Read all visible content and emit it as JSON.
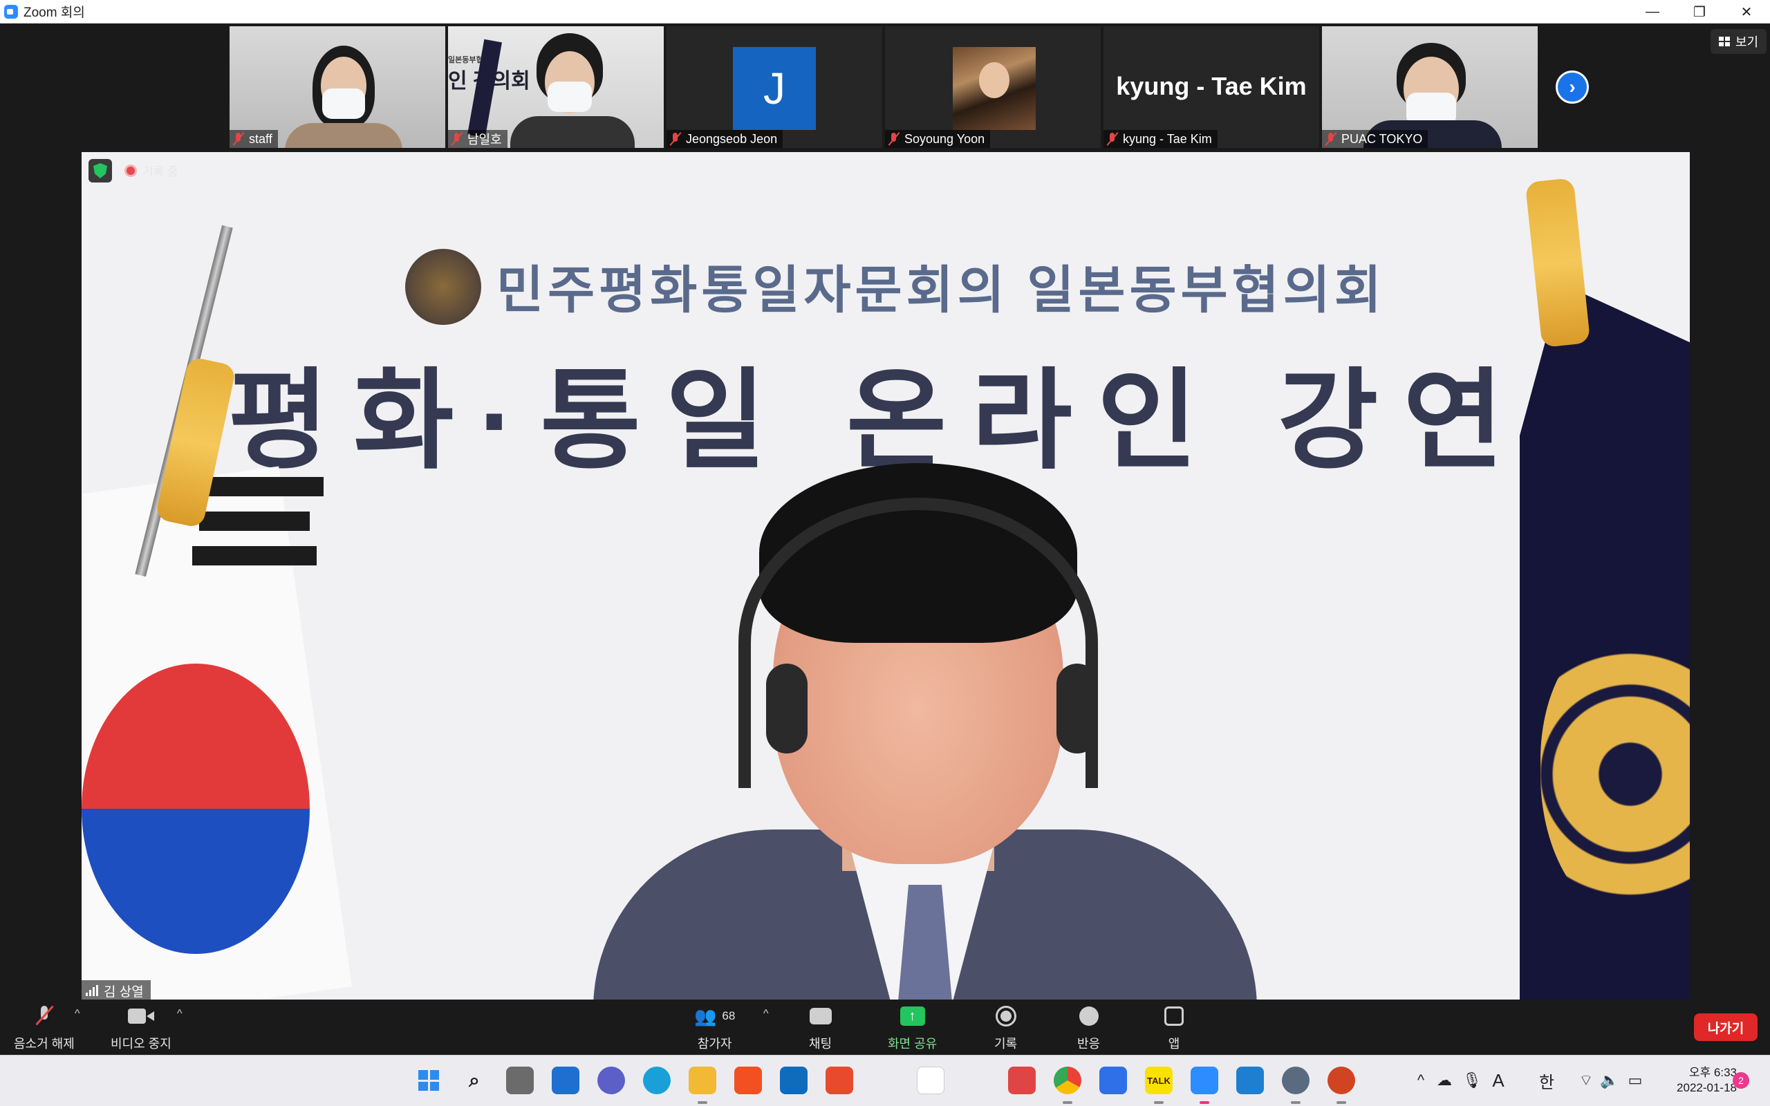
{
  "window": {
    "title": "Zoom 회의",
    "minimize": "—",
    "restore": "❐",
    "close": "✕"
  },
  "view_button": {
    "label": "보기"
  },
  "participants": [
    {
      "name": "staff",
      "type": "video"
    },
    {
      "name": "남일호",
      "type": "video"
    },
    {
      "name": "Jeongseob Jeon",
      "type": "avatar",
      "initial": "J"
    },
    {
      "name": "Soyoung Yoon",
      "type": "photo"
    },
    {
      "name": "kyung - Tae Kim",
      "type": "name-only",
      "display_name": "kyung - Tae Kim"
    },
    {
      "name": "PUAC TOKYO",
      "type": "video"
    }
  ],
  "thumbnail_banner_text": {
    "small": "일본동부협의",
    "large": "인 강의회"
  },
  "main_video": {
    "speaker": "김 상열",
    "recording_label": "기록 중",
    "banner_line1": "민주평화통일자문회의 일본동부협의회",
    "banner_line2": "평화·통일 온라인 강연"
  },
  "controls": {
    "unmute": "음소거 해제",
    "stop_video": "비디오 중지",
    "participants_label": "참가자",
    "participants_count": "68",
    "chat": "채팅",
    "share_screen": "화면 공유",
    "record": "기록",
    "reactions": "반응",
    "apps": "앱",
    "leave": "나가기"
  },
  "taskbar": {
    "tray_ime_a": "A",
    "tray_ime_han": "한",
    "time": "오후 6:33",
    "date": "2022-01-18",
    "notification_count": "2",
    "kakaotalk_label": "TALK"
  },
  "colors": {
    "zoom_blue": "#2d8cff",
    "share_green": "#22c55e",
    "leave_red": "#e02828",
    "muted_red": "#e54545"
  }
}
